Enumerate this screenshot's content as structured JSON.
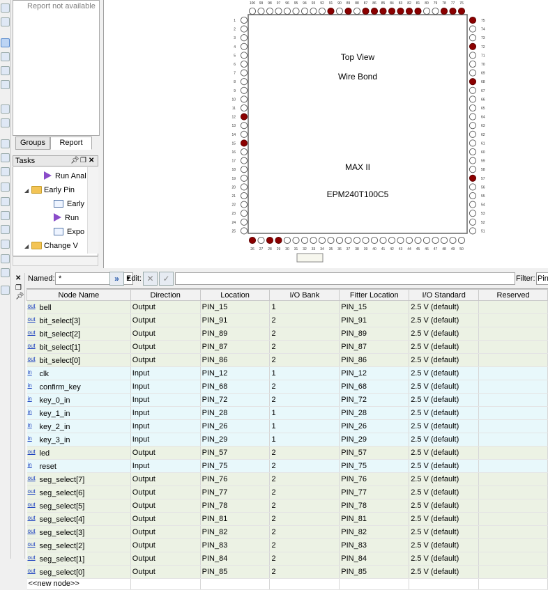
{
  "left_toolbar": {
    "buttons": [
      "tool-a",
      "tool-b",
      "select-tool",
      "zoom-tool",
      "hand-tool",
      "fit-tool",
      "undo",
      "redo",
      "view-a",
      "view-b",
      "view-c",
      "view-d",
      "view-e",
      "view-f",
      "view-g",
      "view-h",
      "view-i",
      "view-j",
      "view-k"
    ]
  },
  "report": {
    "message": "Report not available",
    "tabs": [
      "Groups",
      "Report"
    ]
  },
  "tasks": {
    "title": "Tasks",
    "items": [
      {
        "label": "Run Anal",
        "icon": "play-icon",
        "indent": 3
      },
      {
        "label": "Early Pin",
        "icon": "folder-icon",
        "indent": 1,
        "expanded": true
      },
      {
        "label": "Early",
        "icon": "document-icon",
        "indent": 4
      },
      {
        "label": "Run",
        "icon": "play-icon",
        "indent": 4
      },
      {
        "label": "Expo",
        "icon": "document-icon",
        "indent": 4
      },
      {
        "label": "Change V",
        "icon": "folder-icon",
        "indent": 1,
        "expanded": true
      }
    ]
  },
  "chip": {
    "top_view": "Top View",
    "wire_bond": "Wire Bond",
    "family": "MAX II",
    "device": "EPM240T100C5",
    "top_pin_numbers": [
      "100",
      "99",
      "98",
      "97",
      "96",
      "95",
      "94",
      "93",
      "92",
      "91",
      "90",
      "89",
      "88",
      "87",
      "86",
      "85",
      "84",
      "83",
      "82",
      "81",
      "80",
      "79",
      "78",
      "77",
      "76"
    ],
    "bottom_pin_numbers": [
      "26",
      "27",
      "28",
      "29",
      "30",
      "31",
      "32",
      "33",
      "34",
      "35",
      "36",
      "37",
      "38",
      "39",
      "40",
      "41",
      "42",
      "43",
      "44",
      "45",
      "46",
      "47",
      "48",
      "49",
      "50"
    ],
    "left_pin_numbers": [
      "1",
      "2",
      "3",
      "4",
      "5",
      "6",
      "7",
      "8",
      "9",
      "10",
      "11",
      "12",
      "13",
      "14",
      "15",
      "16",
      "17",
      "18",
      "19",
      "20",
      "21",
      "22",
      "23",
      "24",
      "25"
    ],
    "right_pin_numbers": [
      "75",
      "74",
      "73",
      "72",
      "71",
      "70",
      "69",
      "68",
      "67",
      "66",
      "65",
      "64",
      "63",
      "62",
      "61",
      "60",
      "59",
      "58",
      "57",
      "56",
      "55",
      "54",
      "53",
      "52",
      "51"
    ],
    "used_pins": [
      12,
      15,
      26,
      28,
      29,
      57,
      68,
      72,
      75,
      76,
      77,
      78,
      81,
      82,
      83,
      84,
      85,
      86,
      87,
      89,
      91
    ],
    "colors": {
      "used": "#8b0000",
      "unused_stroke": "#555555",
      "body_stroke": "#666666"
    }
  },
  "toolbar": {
    "named_label": "Named:",
    "named_value": "*",
    "edit_label": "Edit:",
    "filter_label": "Filter:",
    "filter_value": "Pin"
  },
  "table": {
    "columns": [
      "Node Name",
      "Direction",
      "Location",
      "I/O Bank",
      "Fitter Location",
      "I/O Standard",
      "Reserved"
    ],
    "rows": [
      {
        "dir_icon": "out",
        "name": "bell",
        "direction": "Output",
        "location": "PIN_15",
        "bank": "1",
        "fitter": "PIN_15",
        "standard": "2.5 V (default)",
        "reserved": ""
      },
      {
        "dir_icon": "out",
        "name": "bit_select[3]",
        "direction": "Output",
        "location": "PIN_91",
        "bank": "2",
        "fitter": "PIN_91",
        "standard": "2.5 V (default)",
        "reserved": ""
      },
      {
        "dir_icon": "out",
        "name": "bit_select[2]",
        "direction": "Output",
        "location": "PIN_89",
        "bank": "2",
        "fitter": "PIN_89",
        "standard": "2.5 V (default)",
        "reserved": ""
      },
      {
        "dir_icon": "out",
        "name": "bit_select[1]",
        "direction": "Output",
        "location": "PIN_87",
        "bank": "2",
        "fitter": "PIN_87",
        "standard": "2.5 V (default)",
        "reserved": ""
      },
      {
        "dir_icon": "out",
        "name": "bit_select[0]",
        "direction": "Output",
        "location": "PIN_86",
        "bank": "2",
        "fitter": "PIN_86",
        "standard": "2.5 V (default)",
        "reserved": ""
      },
      {
        "dir_icon": "in",
        "name": "clk",
        "direction": "Input",
        "location": "PIN_12",
        "bank": "1",
        "fitter": "PIN_12",
        "standard": "2.5 V (default)",
        "reserved": ""
      },
      {
        "dir_icon": "in",
        "name": "confirm_key",
        "direction": "Input",
        "location": "PIN_68",
        "bank": "2",
        "fitter": "PIN_68",
        "standard": "2.5 V (default)",
        "reserved": ""
      },
      {
        "dir_icon": "in",
        "name": "key_0_in",
        "direction": "Input",
        "location": "PIN_72",
        "bank": "2",
        "fitter": "PIN_72",
        "standard": "2.5 V (default)",
        "reserved": ""
      },
      {
        "dir_icon": "in",
        "name": "key_1_in",
        "direction": "Input",
        "location": "PIN_28",
        "bank": "1",
        "fitter": "PIN_28",
        "standard": "2.5 V (default)",
        "reserved": ""
      },
      {
        "dir_icon": "in",
        "name": "key_2_in",
        "direction": "Input",
        "location": "PIN_26",
        "bank": "1",
        "fitter": "PIN_26",
        "standard": "2.5 V (default)",
        "reserved": ""
      },
      {
        "dir_icon": "in",
        "name": "key_3_in",
        "direction": "Input",
        "location": "PIN_29",
        "bank": "1",
        "fitter": "PIN_29",
        "standard": "2.5 V (default)",
        "reserved": ""
      },
      {
        "dir_icon": "out",
        "name": "led",
        "direction": "Output",
        "location": "PIN_57",
        "bank": "2",
        "fitter": "PIN_57",
        "standard": "2.5 V (default)",
        "reserved": ""
      },
      {
        "dir_icon": "in",
        "name": "reset",
        "direction": "Input",
        "location": "PIN_75",
        "bank": "2",
        "fitter": "PIN_75",
        "standard": "2.5 V (default)",
        "reserved": ""
      },
      {
        "dir_icon": "out",
        "name": "seg_select[7]",
        "direction": "Output",
        "location": "PIN_76",
        "bank": "2",
        "fitter": "PIN_76",
        "standard": "2.5 V (default)",
        "reserved": ""
      },
      {
        "dir_icon": "out",
        "name": "seg_select[6]",
        "direction": "Output",
        "location": "PIN_77",
        "bank": "2",
        "fitter": "PIN_77",
        "standard": "2.5 V (default)",
        "reserved": ""
      },
      {
        "dir_icon": "out",
        "name": "seg_select[5]",
        "direction": "Output",
        "location": "PIN_78",
        "bank": "2",
        "fitter": "PIN_78",
        "standard": "2.5 V (default)",
        "reserved": ""
      },
      {
        "dir_icon": "out",
        "name": "seg_select[4]",
        "direction": "Output",
        "location": "PIN_81",
        "bank": "2",
        "fitter": "PIN_81",
        "standard": "2.5 V (default)",
        "reserved": ""
      },
      {
        "dir_icon": "out",
        "name": "seg_select[3]",
        "direction": "Output",
        "location": "PIN_82",
        "bank": "2",
        "fitter": "PIN_82",
        "standard": "2.5 V (default)",
        "reserved": ""
      },
      {
        "dir_icon": "out",
        "name": "seg_select[2]",
        "direction": "Output",
        "location": "PIN_83",
        "bank": "2",
        "fitter": "PIN_83",
        "standard": "2.5 V (default)",
        "reserved": ""
      },
      {
        "dir_icon": "out",
        "name": "seg_select[1]",
        "direction": "Output",
        "location": "PIN_84",
        "bank": "2",
        "fitter": "PIN_84",
        "standard": "2.5 V (default)",
        "reserved": ""
      },
      {
        "dir_icon": "out",
        "name": "seg_select[0]",
        "direction": "Output",
        "location": "PIN_85",
        "bank": "2",
        "fitter": "PIN_85",
        "standard": "2.5 V (default)",
        "reserved": ""
      }
    ],
    "new_node": "<<new node>>"
  }
}
